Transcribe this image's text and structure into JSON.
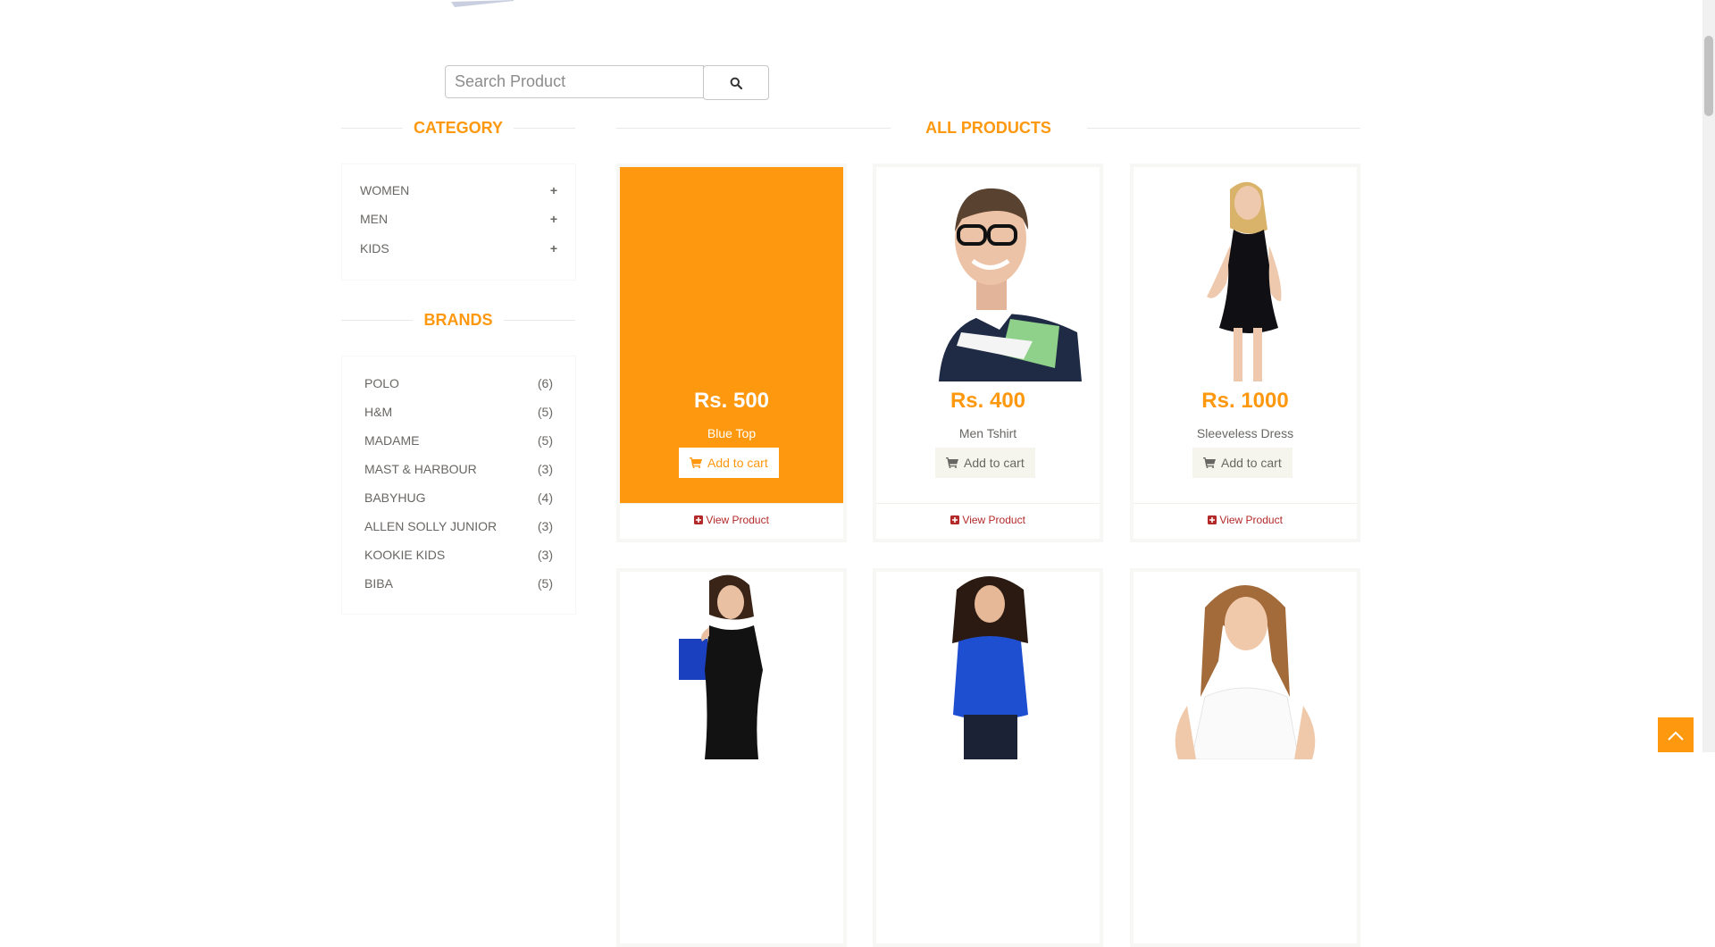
{
  "search": {
    "placeholder": "Search Product",
    "button_icon": "search-icon"
  },
  "sidebar": {
    "category_title": "CATEGORY",
    "categories": [
      {
        "label": "WOMEN",
        "icon": "plus-icon"
      },
      {
        "label": "MEN",
        "icon": "plus-icon"
      },
      {
        "label": "KIDS",
        "icon": "plus-icon"
      }
    ],
    "brands_title": "BRANDS",
    "brands": [
      {
        "name": "POLO",
        "count": "(6)"
      },
      {
        "name": "H&M",
        "count": "(5)"
      },
      {
        "name": "MADAME",
        "count": "(5)"
      },
      {
        "name": "MAST & HARBOUR",
        "count": "(3)"
      },
      {
        "name": "BABYHUG",
        "count": "(4)"
      },
      {
        "name": "ALLEN SOLLY JUNIOR",
        "count": "(3)"
      },
      {
        "name": "KOOKIE KIDS",
        "count": "(3)"
      },
      {
        "name": "BIBA",
        "count": "(5)"
      }
    ]
  },
  "main": {
    "title": "ALL PRODUCTS",
    "products": [
      {
        "price": "Rs. 500",
        "name": "Blue Top",
        "cart_label": "Add to cart",
        "view_label": "View Product",
        "hovered": true
      },
      {
        "price": "Rs. 400",
        "name": "Men Tshirt",
        "cart_label": "Add to cart",
        "view_label": "View Product",
        "hovered": false
      },
      {
        "price": "Rs. 1000",
        "name": "Sleeveless Dress",
        "cart_label": "Add to cart",
        "view_label": "View Product",
        "hovered": false
      }
    ]
  },
  "colors": {
    "accent": "#fe980f",
    "text": "#696763",
    "view_link": "#b3292a"
  },
  "scrollup_icon": "chevron-up-icon"
}
